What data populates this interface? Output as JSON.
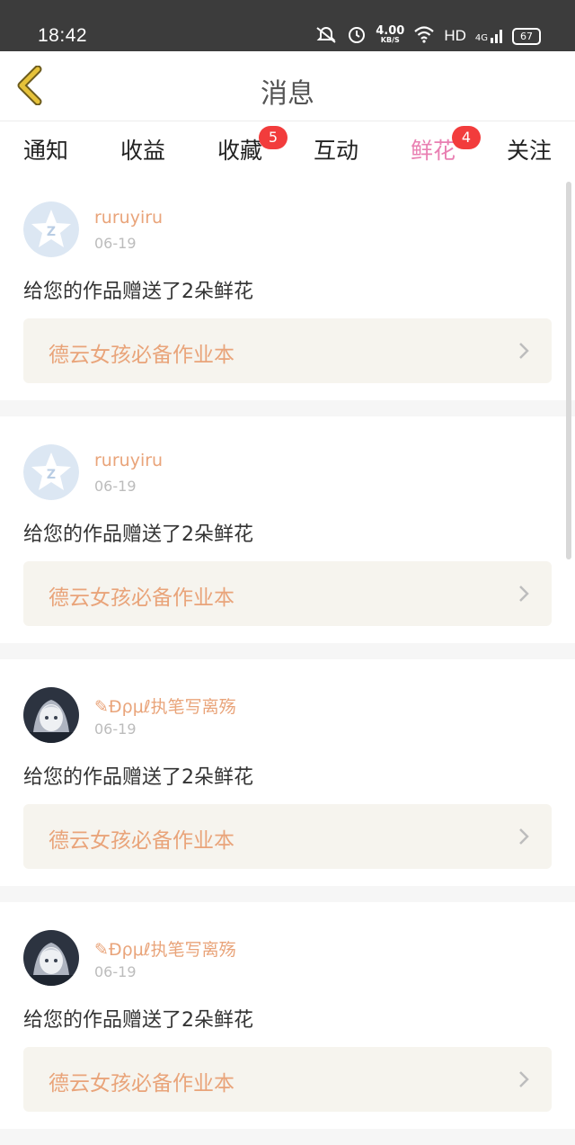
{
  "status_bar": {
    "time": "18:42",
    "net_speed": "4.00",
    "net_unit": "KB/S",
    "network_type": "HD",
    "signal": "4G",
    "battery": "67"
  },
  "header": {
    "title": "消息"
  },
  "tabs": [
    {
      "label": "通知"
    },
    {
      "label": "收益"
    },
    {
      "label": "收藏",
      "badge": "5"
    },
    {
      "label": "互动"
    },
    {
      "label": "鲜花",
      "badge": "4",
      "active": true
    },
    {
      "label": "关注"
    }
  ],
  "messages": [
    {
      "user": "ruruyiru",
      "date": "06-19",
      "text": "给您的作品赠送了2朵鲜花",
      "work": "德云女孩必备作业本"
    },
    {
      "user": "ruruyiru",
      "date": "06-19",
      "text": "给您的作品赠送了2朵鲜花",
      "work": "德云女孩必备作业本"
    },
    {
      "user": "✎Ɖρμℓ执笔写离殇",
      "date": "06-19",
      "text": "给您的作品赠送了2朵鲜花",
      "work": "德云女孩必备作业本"
    },
    {
      "user": "✎Ɖρμℓ执笔写离殇",
      "date": "06-19",
      "text": "给您的作品赠送了2朵鲜花",
      "work": "德云女孩必备作业本"
    }
  ],
  "colors": {
    "accent": "#e97fb2",
    "username": "#e9a47a",
    "badge": "#f23c3c",
    "back_arrow": "#e6c23a"
  }
}
